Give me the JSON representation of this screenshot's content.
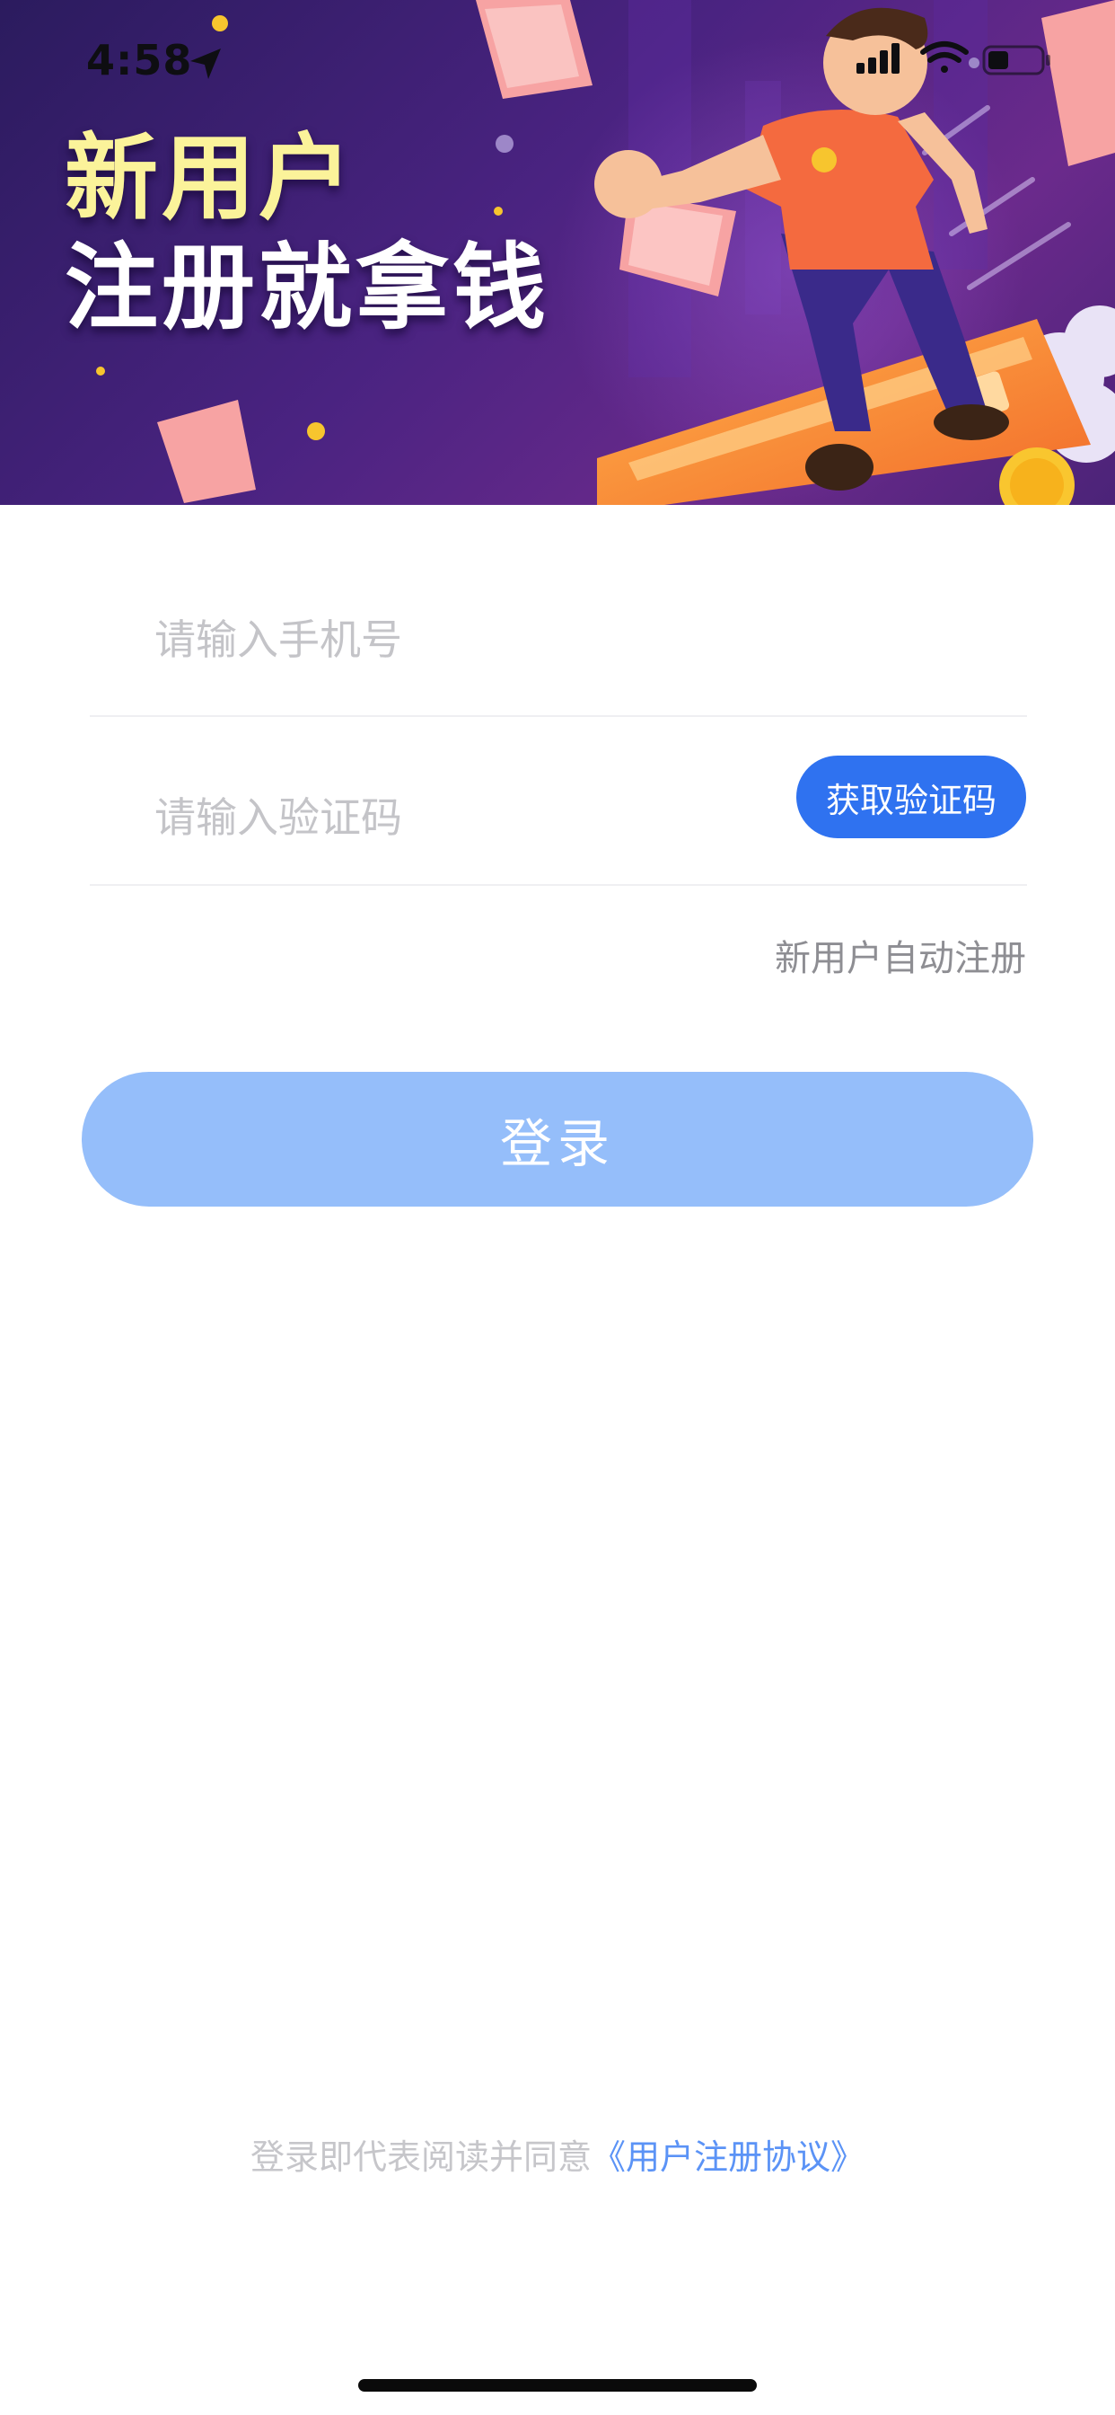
{
  "status_bar": {
    "time": "4:58",
    "location_icon": "location-arrow-icon",
    "signal_icon": "cellular-signal-icon",
    "wifi_icon": "wifi-icon",
    "battery_icon": "battery-icon"
  },
  "banner": {
    "headline_line1": "新用户",
    "headline_line2": "注册就拿钱",
    "illustration": "person-surfing-on-bank-card-with-flying-banknotes",
    "colors": {
      "background": "#4a2381",
      "headline_highlight": "#fbf39a"
    }
  },
  "form": {
    "phone_placeholder": "请输入手机号",
    "code_placeholder": "请输入验证码",
    "get_code_label": "获取验证码",
    "auto_register_hint": "新用户自动注册",
    "login_label": "登录"
  },
  "footer": {
    "agreement_prefix": "登录即代表阅读并同意",
    "agreement_link": "《用户注册协议》"
  },
  "colors": {
    "accent": "#2f72f0",
    "login_button_disabled": "#95befa",
    "link": "#5b93f6",
    "placeholder": "#c4c4c8"
  }
}
